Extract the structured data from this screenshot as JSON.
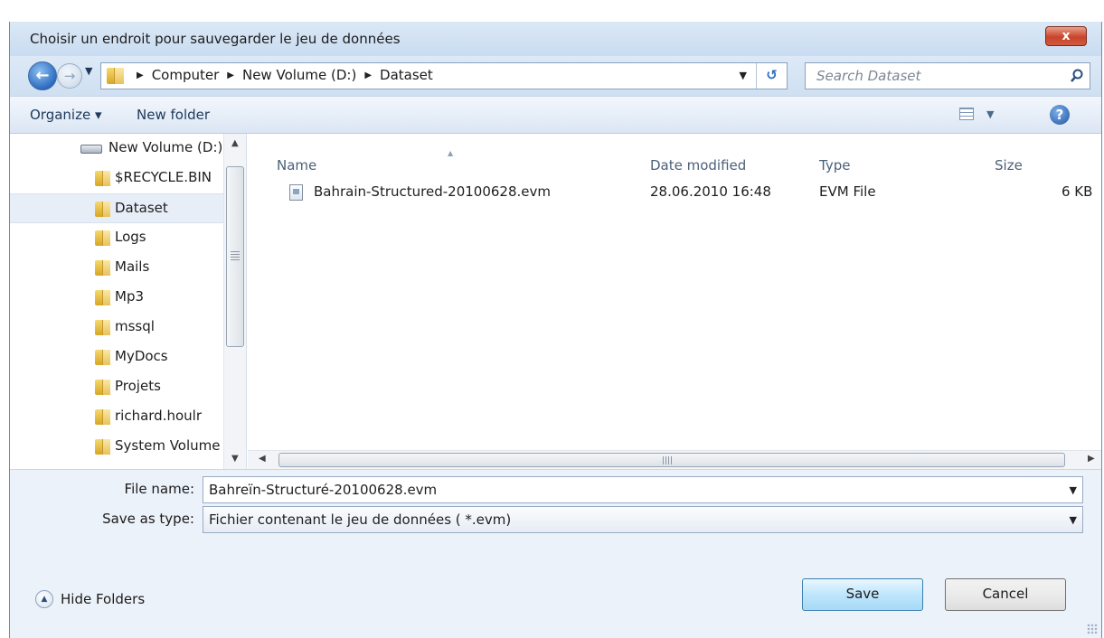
{
  "window": {
    "title": "Choisir un endroit pour sauvegarder le jeu de données",
    "close_label": "x"
  },
  "nav": {
    "breadcrumbs": [
      "Computer",
      "New Volume (D:)",
      "Dataset"
    ],
    "search_placeholder": "Search Dataset"
  },
  "toolbar": {
    "organize_label": "Organize ▾",
    "new_folder_label": "New folder",
    "help_label": "?"
  },
  "tree": {
    "items": [
      {
        "label": "New Volume (D:)",
        "type": "drive",
        "selected": false
      },
      {
        "label": "$RECYCLE.BIN",
        "type": "folder",
        "selected": false
      },
      {
        "label": "Dataset",
        "type": "folder",
        "selected": true
      },
      {
        "label": "Logs",
        "type": "folder",
        "selected": false
      },
      {
        "label": "Mails",
        "type": "folder",
        "selected": false
      },
      {
        "label": "Mp3",
        "type": "folder",
        "selected": false
      },
      {
        "label": "mssql",
        "type": "folder",
        "selected": false
      },
      {
        "label": "MyDocs",
        "type": "folder",
        "selected": false
      },
      {
        "label": "Projets",
        "type": "folder",
        "selected": false
      },
      {
        "label": "richard.houlr",
        "type": "folder",
        "selected": false
      },
      {
        "label": "System Volume Information",
        "type": "folder",
        "selected": false
      }
    ]
  },
  "filelist": {
    "columns": [
      "Name",
      "Date modified",
      "Type",
      "Size"
    ],
    "rows": [
      {
        "name": "Bahrain-Structured-20100628.evm",
        "date": "28.06.2010 16:48",
        "type": "EVM File",
        "size": "6 KB"
      }
    ]
  },
  "form": {
    "filename_label": "File name:",
    "filename_value": "Bahreïn-Structuré-20100628.evm",
    "savetype_label": "Save as type:",
    "savetype_value": "Fichier contenant le jeu de données  ( *.evm)",
    "hide_folders_label": "Hide Folders",
    "save_label": "Save",
    "cancel_label": "Cancel"
  },
  "colors": {
    "accent": "#3c7fb1",
    "window_bg": "#dfe9f5",
    "close_red": "#c7452a"
  },
  "icons": [
    "back-arrow-icon",
    "forward-arrow-icon",
    "folder-icon",
    "refresh-icon",
    "search-icon",
    "views-icon",
    "help-icon",
    "drive-icon",
    "file-icon",
    "hide-folders-icon"
  ]
}
